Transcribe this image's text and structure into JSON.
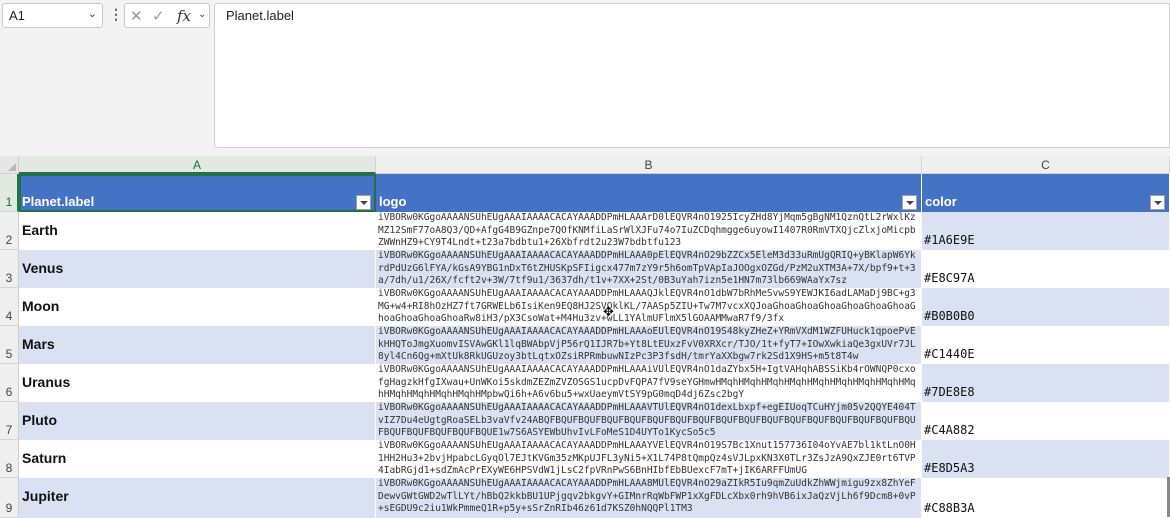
{
  "namebox": {
    "value": "A1"
  },
  "formula_bar": {
    "value": "Planet.label"
  },
  "icons": {
    "cancel": "x-icon",
    "enter": "check-icon",
    "function": "fx-icon"
  },
  "columns": [
    {
      "letter": "A",
      "header": "Planet.label"
    },
    {
      "letter": "B",
      "header": "logo"
    },
    {
      "letter": "C",
      "header": "color"
    }
  ],
  "rows": [
    {
      "num": "1"
    },
    {
      "num": "2",
      "label": "Earth",
      "logo": "iVBORw0KGgoAAAANSUhEUgAAAIAAAACACAYAAADDPmHLAAArD0lEQVR4nO1925IcyZHd8YjMqm5gBgNM1QznQtL2rWxlKzMZ12SmF77oA8Q3/QD+AfgG4B9GZnpe7QOfKNMfiLaSrWlXJFu74o7IuZCDqhmgge6uyowI1407R0RmVTXQjcZlxjoMicpbZWWnHZ9+CY9T4Lndt+t23a7bdbtu1+26Xbfrdt2u23W7bdbtfu123",
      "color": "#1A6E9E"
    },
    {
      "num": "3",
      "label": "Venus",
      "logo": "iVBORw0KGgoAAAANSUhEUgAAAIAAAACACAYAAADDPmHLAAA0pElEQVR4nO29bZZCx5EleM3d33uRmUgQRIQ+yBKlapW6YkrdPdUzG6lFYA/kGsA9YBG1nDxT6tZHUSKpSFIigcx477m7zY9r5h6omTpVApIaJOOgxOZGd/PzM2uXTM3A+7X/bpf9+t+3a/7dh/u1/26X/fcft2v+3W/7tf9u1/3637dh/t1v+7XX+2St/0B3uYah7izn5e1HN7m73lb669WAaYx7sz",
      "color": "#E8C97A"
    },
    {
      "num": "4",
      "label": "Moon",
      "logo": "iVBORw0KGgoAAAANSUhEUgAAAIAAAACACAYAAADDPmHLAAAQJklEQVR4nO1dbW7bRhMeSvwS9YEWJKI6adLAMaDj9BC+g3MG+w4+RI8hOzHZ7ft7GRWELb6IsiKen9EQ8HJ2SVOklKL/7AASp5ZIU+Tw7M7vcxXQJoaGhoaGhoaGhoaGhoaGhoaGhoaGhoaGhoaGhoaGhoaRw8iH3/pX3CsoWat+M4Hu3zv+wLL1YAlmUFlmX5lGOAAMMwaR7f9/3fx",
      "color": "#B0B0B0"
    },
    {
      "num": "5",
      "label": "Mars",
      "logo": "iVBORw0KGgoAAAANSUhEUgAAAIAAAACACAYAAADDPmHLAAAoEUlEQVR4nO19S48kyZHeZ+YRmVXdM1WZFUHuck1qpoePvEkHHQToJmgXuomvISVAwGKl1lqBWAbpVjP56rQ1IJR7b+Yt8LtEUxzFvV0XRXcr/TJO/1t+fyT7+IOwXwkiaQe3gxUVr7JL8yl4Cn6Qg+mXtUk8RkUGUzoy3btLqtxOZsiRPRmbuwNIzPc3P3fsdH/tmrYaXXbgw7rk2Sd1X9HS+m5t8T4w",
      "color": "#C1440E"
    },
    {
      "num": "6",
      "label": "Uranus",
      "logo": "iVBORw0KGgoAAAANSUhEUgAAAIAAAACACAYAAADDPmHLAAAiVUlEQVR4nO1daZYbx5H+IgtVAHqhABSSiKb4rOWNQP0cxofgHagzkHfgIXwau+UnWKoi5skdmZEZmZVZOSGS1ucpDvFQPA7fV9seYGHmwHMqhHMqhHMqhHMqhHMqhHMqhHMqhHMqhHMqhHMqhHMqhHMqhHMqhHMpbwQi6h+A6v6bu5+wxUaeymVtSY9pG0mqD4dj6Zsc2bgY",
      "color": "#7DE8E8"
    },
    {
      "num": "7",
      "label": "Pluto",
      "logo": "iVBORw0KGgoAAAANSUhEUgAAAIAAAACACAYAAADDPmHLAAAVTUlEQVR4nO1dexLbxpf+egEIUoqTCuHYjm05v2QQYE404TvIZ7Du4eUgtgRoaSELb3vaVfv24ABQFBQUFBQUFBQUFBQUFBQUFBQUFBQUFBQUFBQUFBQUFBQUFBQUFBQUFBQUFBQUFBQUFBQUFBQUFBQUFBQUFBQUE1w7S6ASYEWbUhvIvLFoMeS1D4UYTo1KycSo5c5",
      "color": "#C4A882"
    },
    {
      "num": "8",
      "label": "Saturn",
      "logo": "iVBORw0KGgoAAAANSUhEUgAAAIAAAACACAYAAADDPmHLAAAYVElEQVR4nO19S7Bc1Xnut157736I04oYvAE7bl1ktLnO0H1HH2Hu3+2bvjHpabcLGyqOl7EJtKVGm35zMKpUJFL3yNi5+X1L74P8tQmpQz4sVJLpxKN3X0TLr3ZsJzA9QxZJE0rt6TVP4IabRGjd1+sdZmAcPrEXyWE6HPSVdW1jLsC2fpVRnPwS6BnHIbfEbBUexcF7mT+jIK6ARFFUmUG",
      "color": "#E8D5A3"
    },
    {
      "num": "9",
      "label": "Jupiter",
      "logo": "iVBORw0KGgoAAAANSUhEUgAAAIAAAACACAYAAADDPmHLAAA8MUlEQVR4nO29aZIkR5Iu9qmZuUdkZhWWjmigu9zx8ZhYeFDewvGWtGWD2wTlLYt/hBbQ2kkbBU1UPjgqv2bkgvY+GIMnrRqWbFWP1xXgFDLcXbx0rh9hVB6ixJaQzVjLh6f9Dcm8+0vP+sEGDU9c2iu1WkPmmeQ1R+p5y+sSrZnRIb46z61d7KSZ0hNQQPl1TM3",
      "color": "#C88B3A"
    }
  ]
}
